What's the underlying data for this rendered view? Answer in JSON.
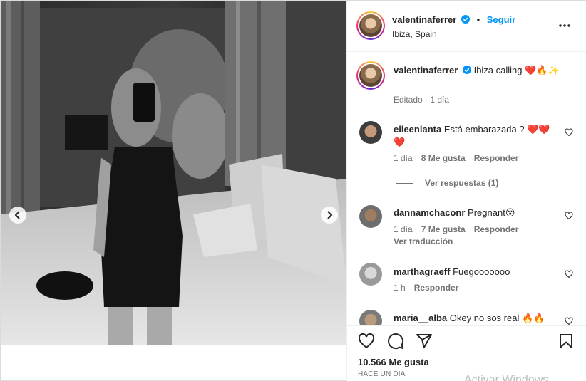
{
  "post": {
    "author": "valentinaferrer",
    "follow_label": "Seguir",
    "location": "Ibiza, Spain",
    "caption": "Ibiza calling",
    "caption_emoji": "❤️🔥✨",
    "edited_label": "Editado",
    "age": "1 día"
  },
  "comments": [
    {
      "user": "eileenlanta",
      "text": "Está embarazada ?",
      "emoji": "❤️❤️❤️",
      "age": "1 día",
      "likes": "8 Me gusta",
      "reply": "Responder",
      "view_replies": "Ver respuestas (1)"
    },
    {
      "user": "dannamchaconr",
      "text": "Pregnant",
      "emoji": "😮",
      "age": "1 día",
      "likes": "7 Me gusta",
      "reply": "Responder",
      "translate": "Ver traducción"
    },
    {
      "user": "marthagraeff",
      "text": "Fuegooooooo",
      "age": "1 h",
      "reply": "Responder"
    },
    {
      "user": "maria__alba",
      "text": "Okey no sos real",
      "emoji": "🔥🔥"
    }
  ],
  "footer": {
    "likes": "10.566 Me gusta",
    "date": "HACE UN DÍA",
    "watermark": "Activar Windows"
  },
  "colors": {
    "verified": "#0095f6",
    "link": "#0095f6",
    "heart": "#ed4956"
  },
  "icons": [
    "verified-icon",
    "more-icon",
    "heart-icon",
    "comment-icon",
    "share-icon",
    "save-icon",
    "chevron-left-icon",
    "chevron-right-icon"
  ]
}
